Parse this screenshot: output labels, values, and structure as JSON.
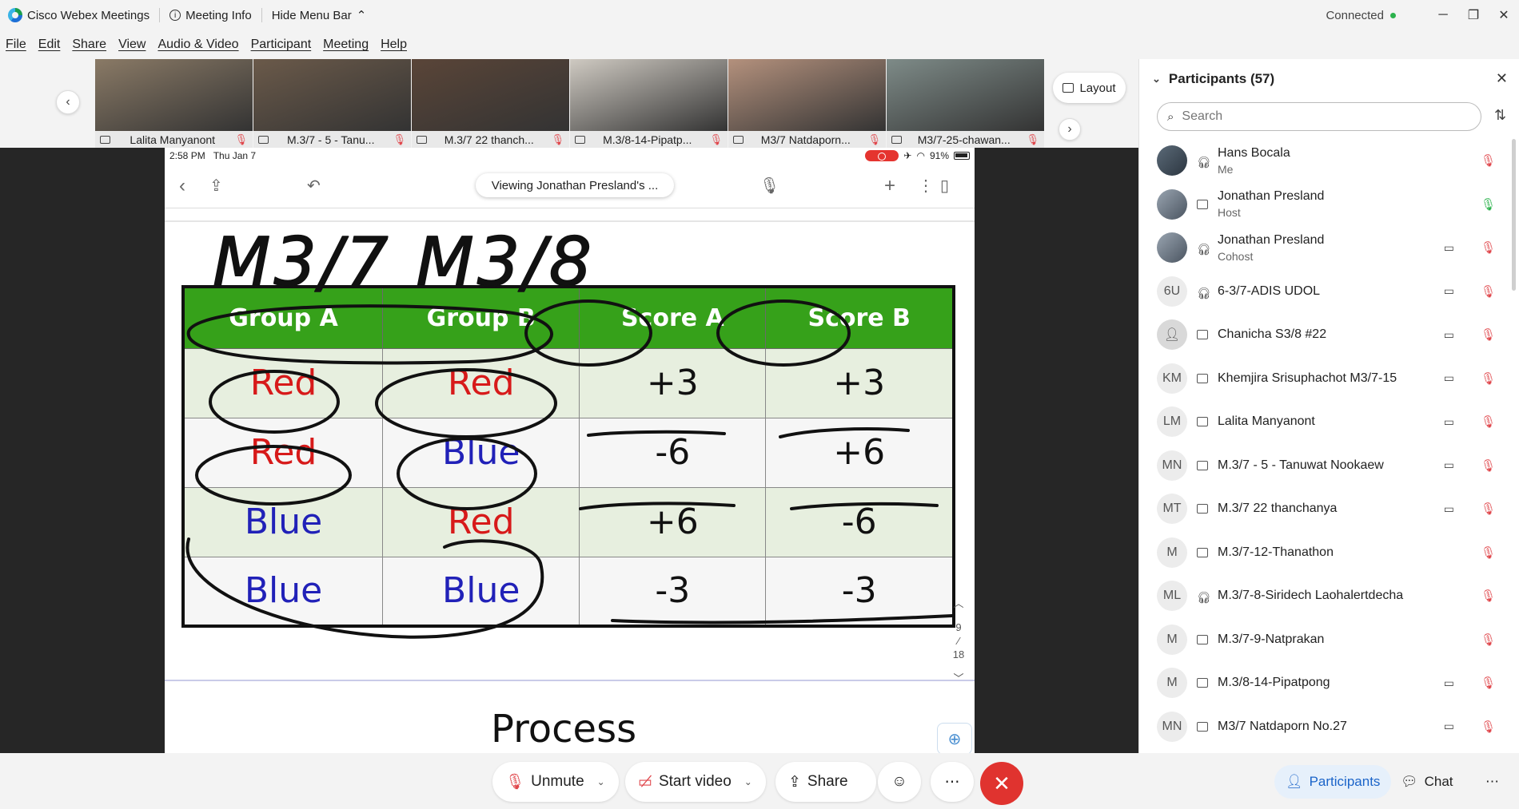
{
  "titlebar": {
    "app_name": "Cisco Webex Meetings",
    "meeting_info": "Meeting Info",
    "hide_menu": "Hide Menu Bar",
    "status": "Connected"
  },
  "menu": [
    "File",
    "Edit",
    "Share",
    "View",
    "Audio & Video",
    "Participant",
    "Meeting",
    "Help"
  ],
  "thumbnails": [
    {
      "name": "Lalita Manyanont",
      "color": "#8a7a66"
    },
    {
      "name": "M.3/7 - 5 - Tanu...",
      "color": "#6b5a4a"
    },
    {
      "name": "M.3/7 22 thanch...",
      "color": "#5a4538"
    },
    {
      "name": "M.3/8-14-Pipatp...",
      "color": "#cfcac2"
    },
    {
      "name": "M3/7 Natdaporn...",
      "color": "#b4917d"
    },
    {
      "name": "M3/7-25-chawan...",
      "color": "#7e8b88"
    }
  ],
  "layout_label": "Layout",
  "ipad": {
    "time": "2:58 PM",
    "date": "Thu Jan 7",
    "battery": "91%",
    "viewing": "Viewing Jonathan Presland's ..."
  },
  "whiteboard": {
    "handwritten_title": "M3/7 M3/8",
    "headers": [
      "Group A",
      "Group B",
      "Score A",
      "Score B"
    ],
    "rows": [
      {
        "a": "Red",
        "a_color": "#d71a1a",
        "b": "Red",
        "b_color": "#d71a1a",
        "sa": "+3",
        "sb": "+3"
      },
      {
        "a": "Red",
        "a_color": "#d71a1a",
        "b": "Blue",
        "b_color": "#2121b8",
        "sa": "-6",
        "sb": "+6"
      },
      {
        "a": "Blue",
        "a_color": "#2121b8",
        "b": "Red",
        "b_color": "#d71a1a",
        "sa": "+6",
        "sb": "-6"
      },
      {
        "a": "Blue",
        "a_color": "#2121b8",
        "b": "Blue",
        "b_color": "#2121b8",
        "sa": "-3",
        "sb": "-3"
      }
    ],
    "page_current": "9",
    "page_total": "18",
    "next_heading": "Process"
  },
  "panel": {
    "title": "Participants (57)",
    "search_placeholder": "Search",
    "participants": [
      {
        "name": "Hans Bocala",
        "role": "Me",
        "avatar": "photo",
        "dev": "audio",
        "cam": false,
        "mic": "off"
      },
      {
        "name": "Jonathan Presland",
        "role": "Host",
        "avatar": "photo2",
        "dev": "screen",
        "cam": false,
        "mic": "on"
      },
      {
        "name": "Jonathan Presland",
        "role": "Cohost",
        "avatar": "photo2",
        "dev": "audio",
        "cam": true,
        "mic": "off"
      },
      {
        "name": "6-3/7-ADIS UDOL",
        "role": "",
        "avatar": "6U",
        "dev": "audio",
        "cam": true,
        "mic": "off"
      },
      {
        "name": "Chanicha S3/8 #22",
        "role": "",
        "avatar": "person",
        "dev": "screen",
        "cam": true,
        "mic": "off"
      },
      {
        "name": "Khemjira Srisuphachot M3/7-15",
        "role": "",
        "avatar": "KM",
        "dev": "screen",
        "cam": true,
        "mic": "off"
      },
      {
        "name": "Lalita Manyanont",
        "role": "",
        "avatar": "LM",
        "dev": "screen",
        "cam": true,
        "mic": "off"
      },
      {
        "name": "M.3/7 - 5 - Tanuwat Nookaew",
        "role": "",
        "avatar": "MN",
        "dev": "screen",
        "cam": true,
        "mic": "off"
      },
      {
        "name": "M.3/7 22 thanchanya",
        "role": "",
        "avatar": "MT",
        "dev": "screen",
        "cam": true,
        "mic": "off"
      },
      {
        "name": "M.3/7-12-Thanathon",
        "role": "",
        "avatar": "M",
        "dev": "screen",
        "cam": false,
        "mic": "off"
      },
      {
        "name": "M.3/7-8-Siridech Laohalertdecha",
        "role": "",
        "avatar": "ML",
        "dev": "audio",
        "cam": false,
        "mic": "off"
      },
      {
        "name": "M.3/7-9-Natprakan",
        "role": "",
        "avatar": "M",
        "dev": "screen",
        "cam": false,
        "mic": "off"
      },
      {
        "name": "M.3/8-14-Pipatpong",
        "role": "",
        "avatar": "M",
        "dev": "screen",
        "cam": true,
        "mic": "off"
      },
      {
        "name": "M3/7 Natdaporn No.27",
        "role": "",
        "avatar": "MN",
        "dev": "screen",
        "cam": true,
        "mic": "off"
      }
    ]
  },
  "controls": {
    "unmute": "Unmute",
    "start_video": "Start video",
    "share": "Share",
    "participants": "Participants",
    "chat": "Chat"
  }
}
